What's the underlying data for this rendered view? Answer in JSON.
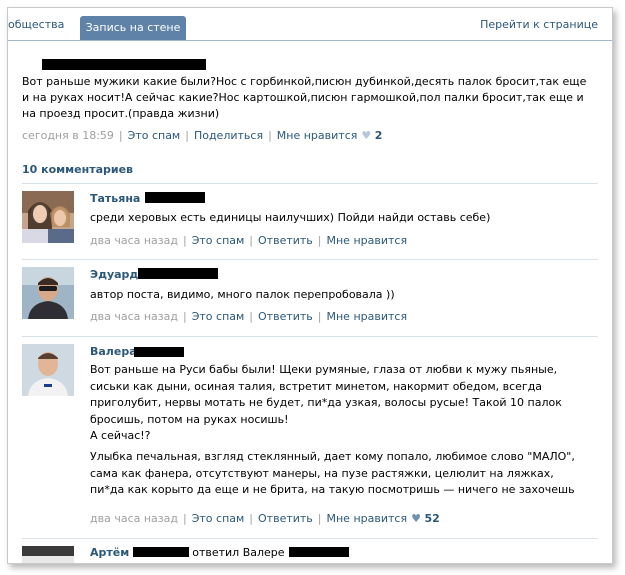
{
  "tabs": {
    "communities": "обществa",
    "wall_post": "Запись на стене",
    "goto_page": "Перейти к странице"
  },
  "post": {
    "text": "Вот раньше мужики какие были?Нос с горбинкой,писюн дубинкой,десять палок бросит,так еще и на руках носит!А сейчас какие?Нос картошкой,писюн гармошкой,пол палки бросит,так еще и на проезд просит.(правда жизни)",
    "time": "сегодня в 18:59",
    "spam": "Это спам",
    "share": "Поделиться",
    "like": "Мне нравится",
    "likes": "2"
  },
  "comments_title": "10 комментариев",
  "comments": [
    {
      "name": "Татьяна",
      "text": "среди херовых есть единицы наилучших) Пойди найди оставь себе)",
      "time": "два часа назад",
      "spam": "Это спам",
      "reply": "Ответить",
      "like": "Мне нравится"
    },
    {
      "name": "Эдуард",
      "text": "автор поста, видимо, много палок перепробовала ))",
      "time": "два часа назад",
      "spam": "Это спам",
      "reply": "Ответить",
      "like": "Мне нравится"
    },
    {
      "name": "Валера",
      "text1": "Вот раньше на Руси бабы были! Щеки румяные, глаза от любви к мужу пьяные, сиськи как дыни, осиная талия, встретит минетом, накормит обедом, всегда приголубит, нервы мотать не будет, пи*да узкая, волосы русые! Такой 10 палок бросишь, потом на руках носишь!",
      "text2": "А сейчас!?",
      "text3": "Улыбка печальная, взгляд стеклянный, дает кому попало, любимое слово \"МАЛО\", сама как фанера, отсутствуют манеры, на пузе растяжки, целюлит на ляжках, пи*да как корыто да еще и не брита, на такую посмотришь — ничего не захочешь",
      "time": "два часа назад",
      "spam": "Это спам",
      "reply": "Ответить",
      "like": "Мне нравится",
      "likes": "52"
    }
  ],
  "last_comment": {
    "name": "Артём",
    "replied": "ответил Валере"
  },
  "colors": {
    "link": "#2b587a",
    "tab_active": "#5e82a8",
    "meta_gray": "#a0a0a0"
  }
}
